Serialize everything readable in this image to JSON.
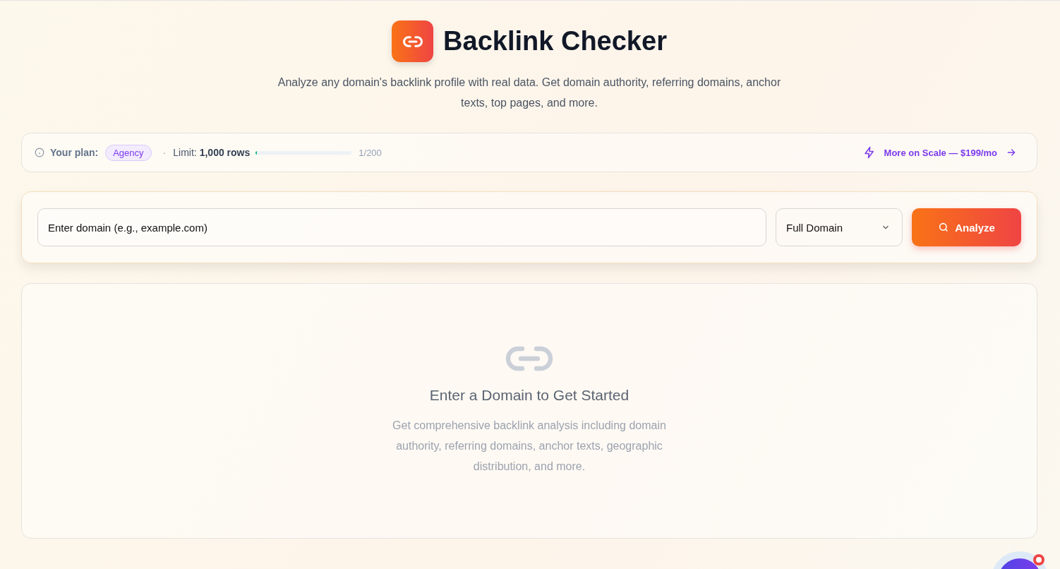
{
  "header": {
    "title": "Backlink Checker",
    "subtitle": "Analyze any domain's backlink profile with real data. Get domain authority, referring domains, anchor texts, top pages, and more."
  },
  "plan_bar": {
    "plan_label": "Your plan:",
    "plan": "Agency",
    "separator": "·",
    "limit_label": "Limit:",
    "limit_value": "1,000 rows",
    "usage": {
      "level": 0.005,
      "reading": "1/200"
    },
    "upgrade_link": "More on Scale — $199/mo"
  },
  "search": {
    "placeholder": "Enter domain (e.g., example.com)",
    "mode": "Full Domain",
    "button": "Analyze"
  },
  "empty_state": {
    "title": "Enter a Domain to Get Started",
    "text": "Get comprehensive backlink analysis including domain authority, referring domains, anchor texts, geographic distribution, and more."
  },
  "chat_widget": {
    "notification": true
  }
}
